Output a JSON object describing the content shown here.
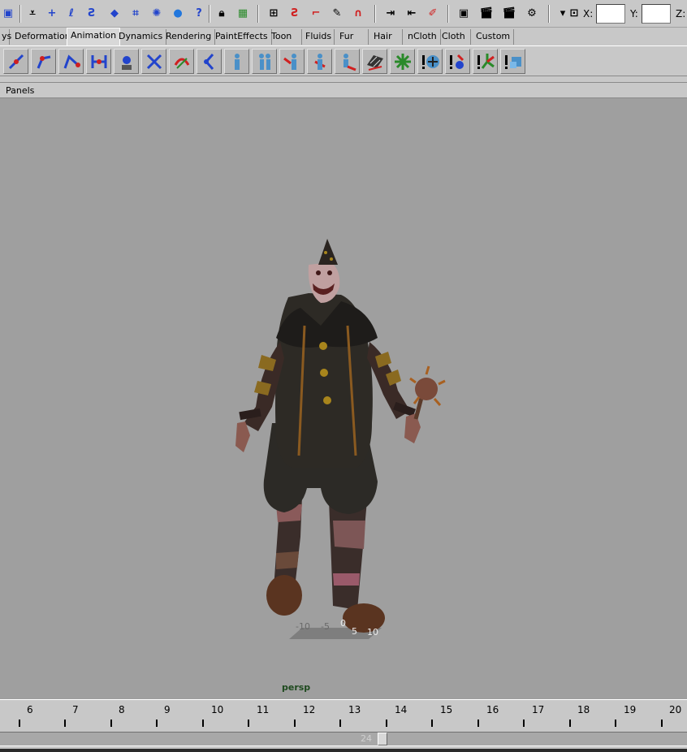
{
  "toolbar": {
    "coords": [
      {
        "label": "X:",
        "value": ""
      },
      {
        "label": "Y:",
        "value": ""
      },
      {
        "label": "Z:",
        "value": ""
      }
    ]
  },
  "shelf_tabs": [
    {
      "label": "ys"
    },
    {
      "label": "Deformation"
    },
    {
      "label": "Animation"
    },
    {
      "label": "Dynamics"
    },
    {
      "label": "Rendering"
    },
    {
      "label": "PaintEffects"
    },
    {
      "label": "Toon"
    },
    {
      "label": "Fluids"
    },
    {
      "label": "Fur"
    },
    {
      "label": "Hair"
    },
    {
      "label": "nCloth"
    },
    {
      "label": "Cloth"
    },
    {
      "label": "Custom"
    }
  ],
  "active_tab": "Animation",
  "panel": {
    "menu_label": "Panels"
  },
  "viewport": {
    "camera_label": "persp",
    "grid_numbers": [
      "-10",
      "-5",
      "0",
      "5",
      "10"
    ]
  },
  "timeline": {
    "ticks": [
      "6",
      "7",
      "8",
      "9",
      "10",
      "11",
      "12",
      "13",
      "14",
      "15",
      "16",
      "17",
      "18",
      "19",
      "20"
    ]
  },
  "range": {
    "end_value": "24"
  },
  "colors": {
    "ui_gray": "#c8c8c8",
    "viewport_gray": "#9f9f9f",
    "camera_label": "#1e4a1e",
    "icon_blue": "#2244cc",
    "icon_red": "#d02020"
  }
}
